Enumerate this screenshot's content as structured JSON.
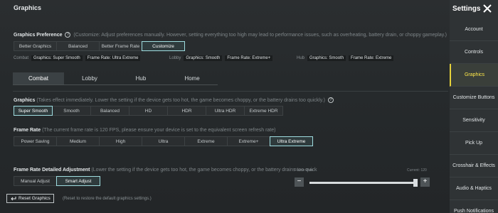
{
  "header": {
    "title": "Graphics",
    "settings_title": "Settings"
  },
  "sidebar": {
    "items": [
      {
        "label": "Account"
      },
      {
        "label": "Controls"
      },
      {
        "label": "Graphics"
      },
      {
        "label": "Customize Buttons"
      },
      {
        "label": "Sensitivity"
      },
      {
        "label": "Pick Up"
      },
      {
        "label": "Crosshair & Effects"
      },
      {
        "label": "Audio & Haptics"
      },
      {
        "label": "Push Notifications"
      }
    ],
    "active_index": 2
  },
  "preference": {
    "title": "Graphics Preference",
    "description": "(Customize: Adjust preferences manually. However, setting everything too high may lead to performance issues, such as overheating, battery drain, or choppy gameplay.)",
    "options": [
      "Better Graphics",
      "Balanced",
      "Better Frame Rate",
      "Customize"
    ],
    "selected": "Customize",
    "summary": {
      "combat_label": "Combat",
      "combat_graphics": "Graphics: Super Smooth",
      "combat_frame": "Frame Rate: Ultra Extreme",
      "lobby_label": "Lobby",
      "lobby_graphics": "Graphics: Smooth",
      "lobby_frame": "Frame Rate: Extreme+",
      "hub_label": "Hub",
      "hub_graphics": "Graphics: Smooth",
      "hub_frame": "Frame Rate: Extreme"
    }
  },
  "tabs": [
    {
      "label": "Combat"
    },
    {
      "label": "Lobby"
    },
    {
      "label": "Hub"
    },
    {
      "label": "Home"
    }
  ],
  "graphics": {
    "title": "Graphics",
    "description": "(Takes effect immediately. Lower the setting if the device gets too hot, the game becomes choppy, or the battery drains too quickly.)",
    "options": [
      "Super Smooth",
      "Smooth",
      "Balanced",
      "HD",
      "HDR",
      "Ultra HDR",
      "Extreme HDR"
    ],
    "selected": "Super Smooth"
  },
  "frame_rate": {
    "title": "Frame Rate",
    "description": "(The current frame rate is 120 FPS, please ensure your device is set to the equivalent screen refresh rate)",
    "options": [
      "Power Saving",
      "Medium",
      "High",
      "Ultra",
      "Extreme",
      "Extreme+",
      "Ultra Extreme"
    ],
    "selected": "Ultra Extreme"
  },
  "adjustment": {
    "title": "Frame Rate Detailed Adjustment",
    "description": "(Lower the setting if the device gets too hot, the game becomes choppy, or the battery drains too quick",
    "options": [
      "Manual Adjust",
      "Smart Adjust"
    ],
    "selected": "Smart Adjust",
    "slider_label": "Frame Rate",
    "current_label": "Current: 120",
    "minus": "−",
    "plus": "+",
    "level": 0.98
  },
  "reset": {
    "label": "Reset Graphics",
    "description": "(Reset to restore the default graphics settings.)"
  },
  "colors": {
    "accent": "#9fdde0",
    "active_nav": "#ffe94a"
  }
}
